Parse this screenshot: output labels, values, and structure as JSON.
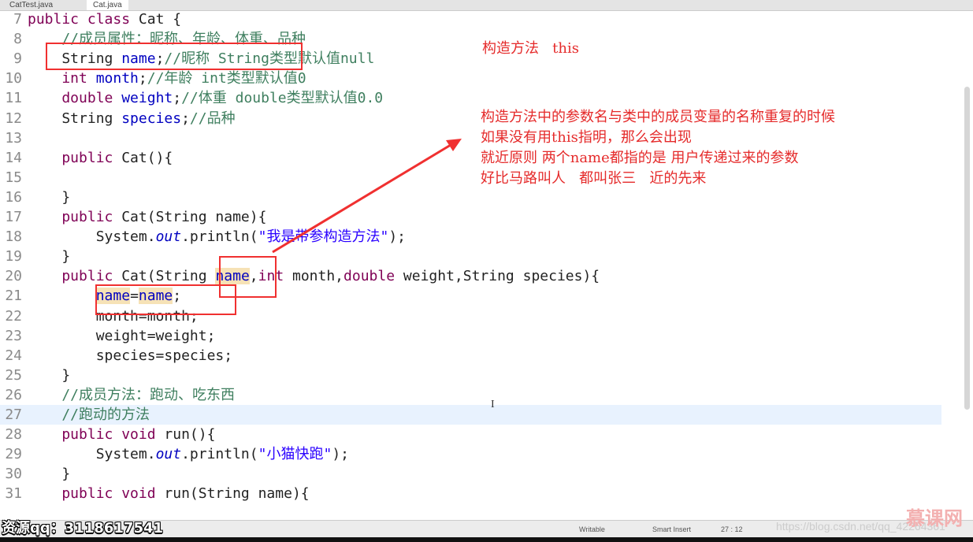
{
  "tabs": [
    "CatTest.java",
    "Cat.java"
  ],
  "code": [
    {
      "n": "7",
      "t": [
        [
          "public class ",
          "kw"
        ],
        [
          "Cat {",
          "ty"
        ]
      ]
    },
    {
      "n": "8",
      "t": [
        [
          "    //成员属性：昵称、年龄、体重、品种",
          "cm"
        ]
      ]
    },
    {
      "n": "9",
      "t": [
        [
          "    String ",
          "ty"
        ],
        [
          "name",
          "fld"
        ],
        [
          ";",
          "ty"
        ],
        [
          "//昵称 String类型默认值null",
          "cm"
        ]
      ]
    },
    {
      "n": "10",
      "t": [
        [
          "    int ",
          "kw"
        ],
        [
          "month",
          "fld"
        ],
        [
          ";",
          "ty"
        ],
        [
          "//年龄 int类型默认值0",
          "cm"
        ]
      ]
    },
    {
      "n": "11",
      "t": [
        [
          "    double ",
          "kw"
        ],
        [
          "weight",
          "fld"
        ],
        [
          ";",
          "ty"
        ],
        [
          "//体重 double类型默认值0.0",
          "cm"
        ]
      ]
    },
    {
      "n": "12",
      "t": [
        [
          "    String ",
          "ty"
        ],
        [
          "species",
          "fld"
        ],
        [
          ";",
          "ty"
        ],
        [
          "//品种",
          "cm"
        ]
      ]
    },
    {
      "n": "13",
      "t": []
    },
    {
      "n": "14",
      "t": [
        [
          "    public ",
          "kw"
        ],
        [
          "Cat(){",
          "ty"
        ]
      ]
    },
    {
      "n": "15",
      "t": []
    },
    {
      "n": "16",
      "t": [
        [
          "    }",
          "ty"
        ]
      ]
    },
    {
      "n": "17",
      "t": [
        [
          "    public ",
          "kw"
        ],
        [
          "Cat(String name){",
          "ty"
        ]
      ]
    },
    {
      "n": "18",
      "t": [
        [
          "        System.",
          "ty"
        ],
        [
          "out",
          "it"
        ],
        [
          ".println(",
          "ty"
        ],
        [
          "\"我是带参构造方法\"",
          "st"
        ],
        [
          ");",
          "ty"
        ]
      ]
    },
    {
      "n": "19",
      "t": [
        [
          "    }",
          "ty"
        ]
      ]
    },
    {
      "n": "20",
      "t": [
        [
          "    public ",
          "kw"
        ],
        [
          "Cat(String ",
          "ty"
        ],
        [
          "name",
          "hl"
        ],
        [
          ",",
          "ty"
        ],
        [
          "int ",
          "kw"
        ],
        [
          "month,",
          "ty"
        ],
        [
          "double ",
          "kw"
        ],
        [
          "weight,String species){",
          "ty"
        ]
      ]
    },
    {
      "n": "21",
      "t": [
        [
          "        ",
          "ty"
        ],
        [
          "name",
          "hl"
        ],
        [
          "=",
          "ty"
        ],
        [
          "name",
          "hl"
        ],
        [
          ";",
          "ty"
        ]
      ]
    },
    {
      "n": "22",
      "t": [
        [
          "        month=month;",
          "ty"
        ]
      ]
    },
    {
      "n": "23",
      "t": [
        [
          "        weight=weight;",
          "ty"
        ]
      ]
    },
    {
      "n": "24",
      "t": [
        [
          "        species=species;",
          "ty"
        ]
      ]
    },
    {
      "n": "25",
      "t": [
        [
          "    }",
          "ty"
        ]
      ]
    },
    {
      "n": "26",
      "t": [
        [
          "    //成员方法：跑动、吃东西",
          "cm"
        ]
      ]
    },
    {
      "n": "27",
      "t": [
        [
          "    //跑动的方法",
          "cm"
        ]
      ]
    },
    {
      "n": "28",
      "t": [
        [
          "    public void ",
          "kw"
        ],
        [
          "run(){",
          "ty"
        ]
      ]
    },
    {
      "n": "29",
      "t": [
        [
          "        System.",
          "ty"
        ],
        [
          "out",
          "it"
        ],
        [
          ".println(",
          "ty"
        ],
        [
          "\"小猫快跑\"",
          "st"
        ],
        [
          ");",
          "ty"
        ]
      ]
    },
    {
      "n": "30",
      "t": [
        [
          "    }",
          "ty"
        ]
      ]
    },
    {
      "n": "31",
      "t": [
        [
          "    public void ",
          "kw"
        ],
        [
          "run(String name){",
          "ty"
        ]
      ]
    }
  ],
  "current_line": "27",
  "notes": {
    "title": "构造方法   this",
    "lines": [
      "构造方法中的参数名与类中的成员变量的名称重复的时候",
      "如果没有用this指明，那么会出现",
      "就近原则 两个name都指的是 用户传递过来的参数",
      "好比马路叫人   都叫张三   近的先来"
    ]
  },
  "status": {
    "mode": "Writable",
    "insert": "Smart Insert",
    "position": "27 : 12"
  },
  "watermark": "资源qq：3118617541",
  "url": "https://blog.csdn.net/qq_42264361",
  "logo": "慕课网",
  "annotation_color": "#f03030"
}
